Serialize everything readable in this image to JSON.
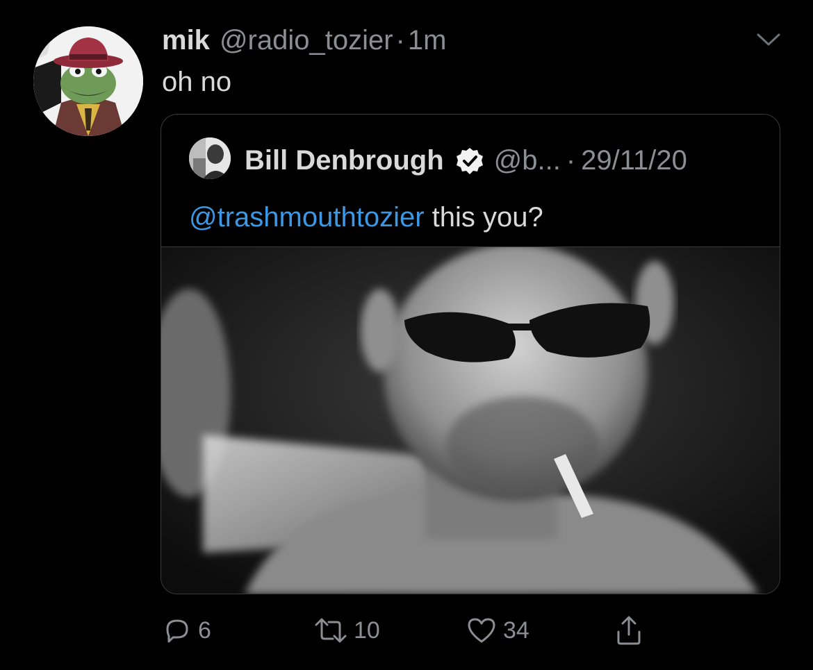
{
  "tweet": {
    "author_name": "mik",
    "author_handle": "@radio_tozier",
    "separator": "·",
    "time": "1m",
    "text": "oh no"
  },
  "quoted": {
    "author_name": "Bill Denbrough",
    "author_handle": "@b...",
    "separator": "·",
    "date": "29/11/20",
    "mention": "@trashmouthtozier",
    "text": " this you?"
  },
  "actions": {
    "reply_count": "6",
    "retweet_count": "10",
    "like_count": "34"
  },
  "icons": {
    "menu": "chevron-down-icon",
    "verified": "verified-badge-icon",
    "reply": "reply-icon",
    "retweet": "retweet-icon",
    "like": "heart-icon",
    "share": "share-icon"
  },
  "colors": {
    "background": "#000000",
    "primary_text": "#d9d9d9",
    "secondary_text": "#8b8f94",
    "link": "#3a98e4",
    "border": "#3a3a3c"
  }
}
